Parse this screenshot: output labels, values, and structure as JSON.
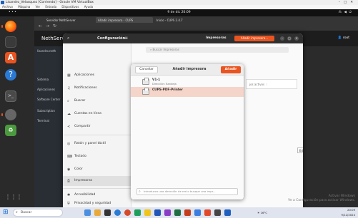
{
  "vbox": {
    "title": "Lisandro_Velasquez [Corriendo] - Oracle VM VirtualBox",
    "menu": [
      "Archivo",
      "Máquina",
      "Ver",
      "Entrada",
      "Dispositivos",
      "Ayuda"
    ]
  },
  "gnome": {
    "activities": "",
    "clock": "9 de dic 20:09"
  },
  "browser": {
    "tabs": [
      "Servidor NethServer",
      "Añadir impresora - CUPS",
      "Inicio - CUPS 2.4.7"
    ]
  },
  "nethserver": {
    "brand": "NethServer",
    "user_menu": "root",
    "sidebar": [
      "Sistema",
      "Aplicaciones",
      "Software Center",
      "Subscription",
      "Terminal"
    ],
    "sidebar_first": "lisandro.neth"
  },
  "settings": {
    "app_title": "Configuración",
    "section_title": "Impresoras",
    "add_printer_button": "Añadir impresora...",
    "search_placeholder": "Buscar Impresoras",
    "sidebar": [
      {
        "label": "Aplicaciones",
        "icon": "apps-icon"
      },
      {
        "label": "Notificaciones",
        "icon": "bell-icon"
      },
      {
        "label": "Buscar",
        "icon": "search-icon"
      },
      {
        "label": "Cuentas en línea",
        "icon": "cloud-icon"
      },
      {
        "label": "Compartir",
        "icon": "share-icon"
      },
      {
        "label": "Ratón y panel táctil",
        "icon": "mouse-icon"
      },
      {
        "label": "Teclado",
        "icon": "keyboard-icon"
      },
      {
        "label": "Color",
        "icon": "color-icon"
      },
      {
        "label": "Impresoras",
        "icon": "printer-icon"
      },
      {
        "label": "Accesibilidad",
        "icon": "accessibility-icon"
      },
      {
        "label": "Privacidad y seguridad",
        "icon": "privacy-icon"
      }
    ],
    "bg_card_text": "jos activos",
    "bg_card2_text": "Editar"
  },
  "modal": {
    "cancel": "Cancelar",
    "title": "Añadir impresora",
    "add": "Añadir",
    "printers": [
      {
        "name": "V1-1",
        "desc": "Dirección: Bandeja"
      },
      {
        "name": "CUPS-PDF-Printer",
        "desc": ""
      }
    ],
    "search_placeholder": "Introduzca una dirección de red o busque una impr..."
  },
  "watermark": {
    "line1": "Activar Windows",
    "line2": "Ve a Configuración para activar Windows."
  },
  "taskbar": {
    "search": "Buscar",
    "weather": "16°C",
    "time": "20:09",
    "date": "9/12/2024"
  }
}
